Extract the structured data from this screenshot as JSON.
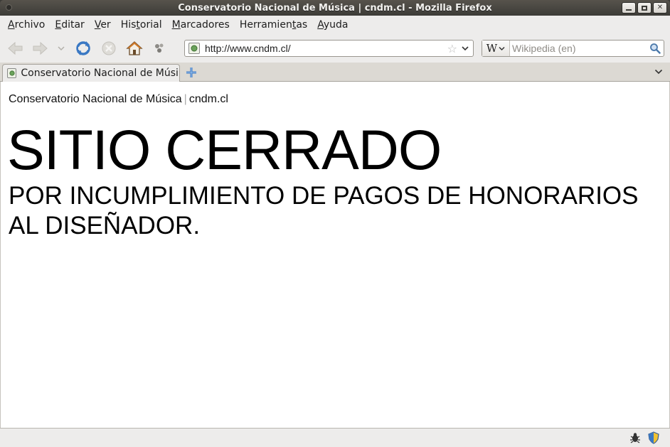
{
  "window": {
    "title": "Conservatorio Nacional de Música | cndm.cl - Mozilla Firefox"
  },
  "menubar": {
    "items": [
      {
        "label": "Archivo",
        "accel_index": 0
      },
      {
        "label": "Editar",
        "accel_index": 0
      },
      {
        "label": "Ver",
        "accel_index": 0
      },
      {
        "label": "Historial",
        "accel_index": 3
      },
      {
        "label": "Marcadores",
        "accel_index": 0
      },
      {
        "label": "Herramientas",
        "accel_index": 9
      },
      {
        "label": "Ayuda",
        "accel_index": 0
      }
    ]
  },
  "navbar": {
    "url": "http://www.cndm.cl/",
    "search_placeholder": "Wikipedia (en)",
    "search_engine_glyph": "W"
  },
  "tabs": [
    {
      "label": "Conservatorio Nacional de Músi...",
      "active": true
    }
  ],
  "page": {
    "header_site": "Conservatorio Nacional de Música",
    "header_sep": "|",
    "header_domain": "cndm.cl",
    "headline": "SITIO CERRADO",
    "subline": "POR INCUMPLIMIENTO DE PAGOS DE HONORARIOS AL DISEÑADOR."
  },
  "colors": {
    "titlebar": "#3c3b37",
    "chrome": "#edeceb",
    "reload_blue": "#3a78c3",
    "home_orange": "#d07a2a"
  }
}
